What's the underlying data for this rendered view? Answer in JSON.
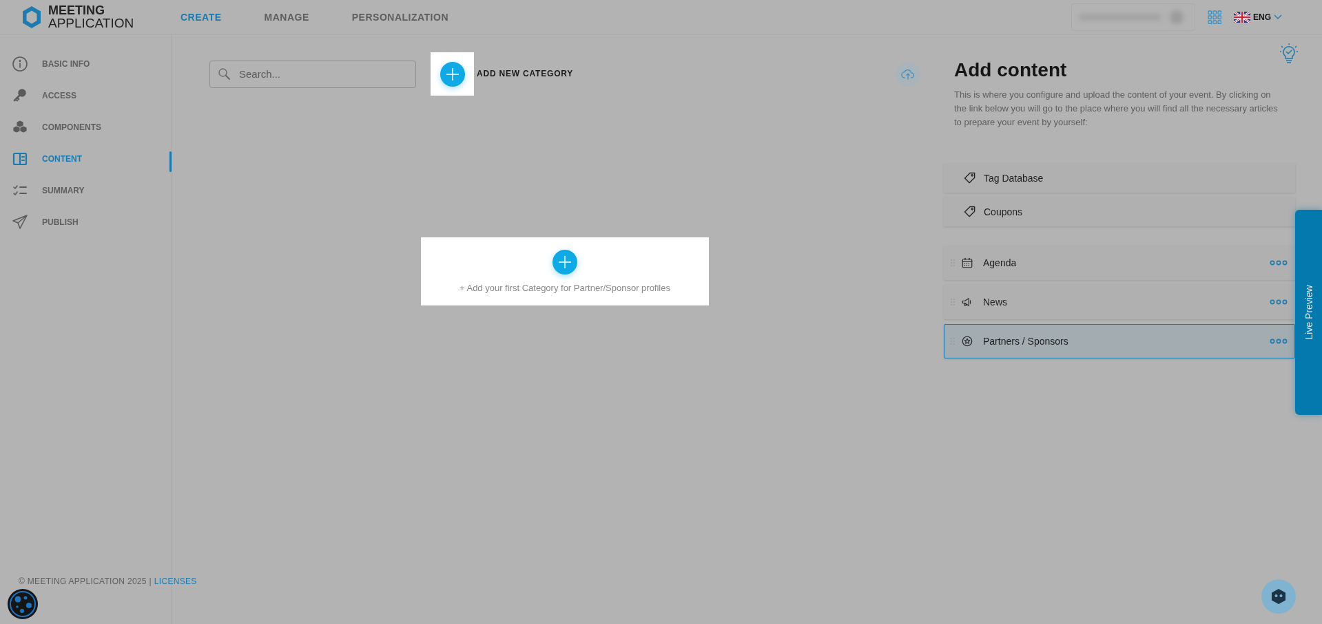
{
  "header": {
    "logo": {
      "line1": "MEETING",
      "line2": "APPLICATION"
    },
    "nav": [
      {
        "label": "CREATE",
        "selected": true
      },
      {
        "label": "MANAGE",
        "selected": false
      },
      {
        "label": "PERSONALIZATION",
        "selected": false
      }
    ],
    "language": "ENG"
  },
  "sidebar": {
    "items": [
      {
        "label": "BASIC INFO",
        "selected": false
      },
      {
        "label": "ACCESS",
        "selected": false
      },
      {
        "label": "COMPONENTS",
        "selected": false
      },
      {
        "label": "CONTENT",
        "selected": true
      },
      {
        "label": "SUMMARY",
        "selected": false
      },
      {
        "label": "PUBLISH",
        "selected": false
      }
    ],
    "footer": {
      "copyright": "© MEETING APPLICATION 2025 |",
      "link": "LICENSES"
    }
  },
  "main": {
    "search": {
      "placeholder": "Search..."
    },
    "add_button": "ADD NEW CATEGORY",
    "empty_state": "+ Add your first Category for Partner/Sponsor profiles"
  },
  "panel": {
    "title": "Add content",
    "description": "This is where you configure and upload the content of your event. By clicking on the link below you will go to the place where you will find all the necessary articles to prepare your event by yourself:",
    "links": [
      "Tag Database",
      "Coupons"
    ],
    "modules": [
      {
        "label": "Agenda",
        "selected": false
      },
      {
        "label": "News",
        "selected": false
      },
      {
        "label": "Partners / Sponsors",
        "selected": true
      }
    ]
  },
  "live_preview": "Live Preview"
}
